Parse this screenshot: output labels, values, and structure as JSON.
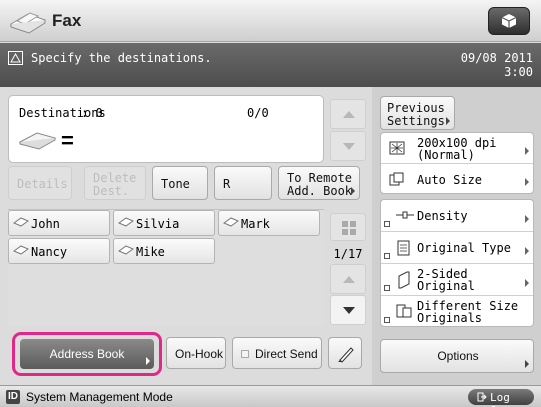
{
  "header": {
    "title": "Fax",
    "top_right_icon": "cube-icon"
  },
  "status": {
    "message": "Specify the destinations.",
    "date": "09/08 2011",
    "time": "3:00",
    "icon": "warning-triangle-icon"
  },
  "destinations": {
    "label": "Destinations",
    "value": ": 0",
    "ratio": "0/0",
    "equals": "="
  },
  "action_buttons": {
    "details": "Details",
    "delete_dest_1": "Delete",
    "delete_dest_2": "Dest.",
    "tone": "Tone",
    "r": "R",
    "to_remote_1": "To Remote",
    "to_remote_2": "Add. Book"
  },
  "address_entries": [
    "John",
    "Silvia",
    "Mark",
    "Nancy",
    "Mike"
  ],
  "list_page": "1/17",
  "bottom": {
    "address_book": "Address Book",
    "on_hook": "On-Hook",
    "direct_send": "Direct Send"
  },
  "settings": {
    "previous_1": "Previous",
    "previous_2": "Settings",
    "resolution_1": "200x100 dpi",
    "resolution_2": "(Normal)",
    "size": "Auto Size",
    "density": "Density",
    "original_type": "Original Type",
    "two_sided_1": "2-Sided",
    "two_sided_2": "Original",
    "diff_size_1": "Different Size",
    "diff_size_2": "Originals",
    "options": "Options"
  },
  "footer": {
    "mode_icon": "ID",
    "mode": "System Management Mode",
    "logout": "Log Out"
  },
  "colors": {
    "highlight": "#e0278a",
    "status_bar": "#5a5a5a"
  }
}
